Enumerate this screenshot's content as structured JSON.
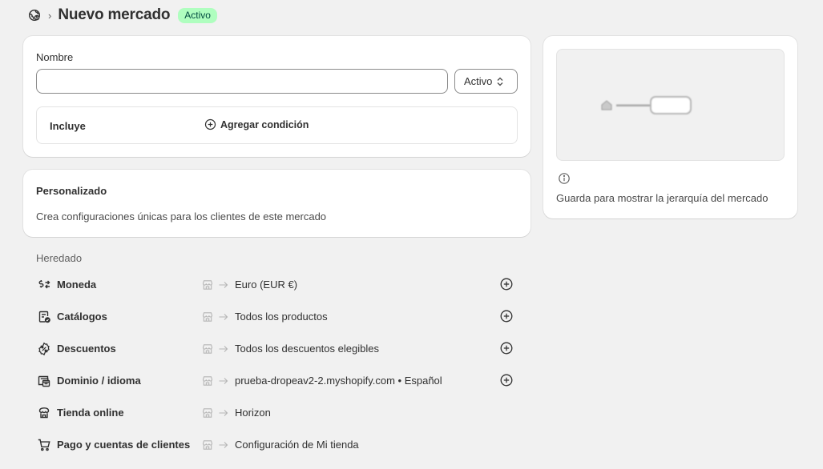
{
  "header": {
    "title": "Nuevo mercado",
    "badge": "Activo",
    "badge_bg": "#affebf",
    "badge_fg": "#014b40"
  },
  "form": {
    "name_label": "Nombre",
    "name_value": "",
    "name_placeholder": "",
    "status_selected": "Activo",
    "includes_label": "Incluye",
    "add_condition_label": "Agregar condición"
  },
  "custom": {
    "title": "Personalizado",
    "description": "Crea configuraciones únicas para los clientes de este mercado"
  },
  "side": {
    "info_text": "Guarda para mostrar la jerarquía del mercado"
  },
  "inherited": {
    "heading": "Heredado",
    "rows": [
      {
        "icon": "currency-exchange-icon",
        "name": "Moneda",
        "value": "Euro (EUR €)",
        "has_add": true
      },
      {
        "icon": "catalog-icon",
        "name": "Catálogos",
        "value": "Todos los productos",
        "has_add": true
      },
      {
        "icon": "discount-icon",
        "name": "Descuentos",
        "value": "Todos los descuentos elegibles",
        "has_add": true
      },
      {
        "icon": "domain-icon",
        "name": "Dominio / idioma",
        "value": "prueba-dropeav2-2.myshopify.com • Español",
        "has_add": true
      },
      {
        "icon": "online-store-icon",
        "name": "Tienda online",
        "value": "Horizon",
        "has_add": false
      },
      {
        "icon": "cart-icon",
        "name": "Pago y cuentas de clientes",
        "value": "Configuración de Mi tienda",
        "has_add": false
      }
    ]
  }
}
